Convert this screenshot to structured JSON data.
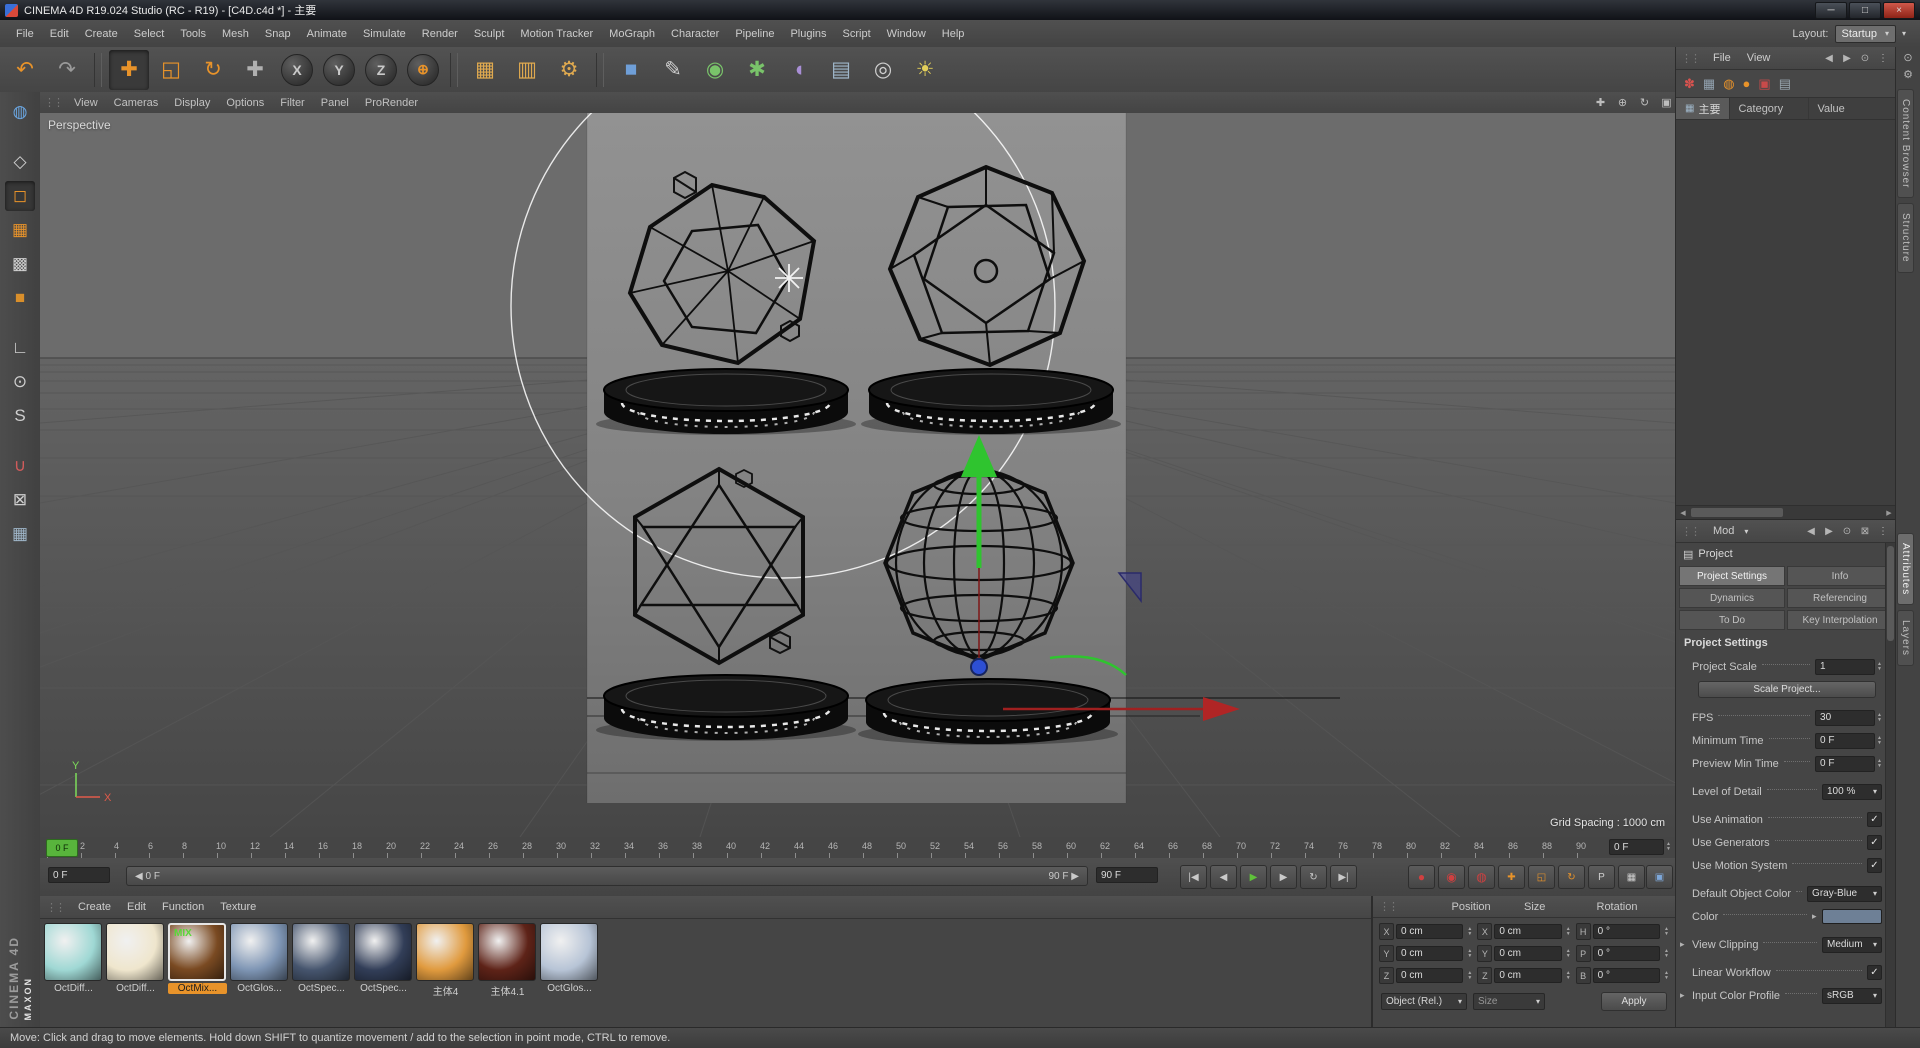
{
  "title_bar": {
    "title": "CINEMA 4D R19.024 Studio (RC - R19) - [C4D.c4d *] - 主要",
    "minimize": "─",
    "maximize": "□",
    "close": "×"
  },
  "menu_bar": {
    "items": [
      "File",
      "Edit",
      "Create",
      "Select",
      "Tools",
      "Mesh",
      "Snap",
      "Animate",
      "Simulate",
      "Render",
      "Sculpt",
      "Motion Tracker",
      "MoGraph",
      "Character",
      "Pipeline",
      "Plugins",
      "Script",
      "Window",
      "Help"
    ],
    "layout_label": "Layout:",
    "layout_value": "Startup"
  },
  "toolbar": {
    "items": [
      {
        "name": "undo-icon",
        "glyph": "↶",
        "fg": "#e8932a"
      },
      {
        "name": "redo-icon",
        "glyph": "↷",
        "fg": "#9a9a9a"
      },
      {
        "name": "toolbar-separator",
        "kind": "sep",
        "inter": "false"
      },
      {
        "name": "move-tool-icon",
        "glyph": "✚",
        "fg": "#e8932a",
        "kind": "active"
      },
      {
        "name": "scale-tool-icon",
        "glyph": "◱",
        "fg": "#e8932a"
      },
      {
        "name": "rotate-tool-icon",
        "glyph": "↻",
        "fg": "#e8932a"
      },
      {
        "name": "last-tool-icon",
        "glyph": "✚",
        "fg": "#b0b0b0"
      },
      {
        "name": "lock-x-axis-icon",
        "glyph": "X",
        "fg": "#c9c9c9",
        "kind": "round"
      },
      {
        "name": "lock-y-axis-icon",
        "glyph": "Y",
        "fg": "#c9c9c9",
        "kind": "round"
      },
      {
        "name": "lock-z-axis-icon",
        "glyph": "Z",
        "fg": "#c9c9c9",
        "kind": "round"
      },
      {
        "name": "coordinate-system-icon",
        "glyph": "⊕",
        "fg": "#e8932a",
        "kind": "round"
      },
      {
        "name": "toolbar-separator",
        "kind": "sep",
        "inter": "false"
      },
      {
        "name": "render-view-icon",
        "glyph": "▦",
        "fg": "#dfa94f"
      },
      {
        "name": "render-picture-viewer-icon",
        "glyph": "▥",
        "fg": "#dfa94f"
      },
      {
        "name": "render-settings-icon",
        "glyph": "⚙",
        "fg": "#dfa94f"
      },
      {
        "name": "toolbar-separator",
        "kind": "sep",
        "inter": "false"
      },
      {
        "name": "primitive-cube-icon",
        "glyph": "■",
        "fg": "#6f9fd8"
      },
      {
        "name": "spline-pen-icon",
        "glyph": "✎",
        "fg": "#cfcfcf"
      },
      {
        "name": "subdivision-surface-icon",
        "glyph": "◉",
        "fg": "#79c36a"
      },
      {
        "name": "cloner-icon",
        "glyph": "✱",
        "fg": "#79c36a"
      },
      {
        "name": "deformer-icon",
        "glyph": "◖",
        "fg": "#a98fd6"
      },
      {
        "name": "array-icon",
        "glyph": "▤",
        "fg": "#9fb6c9"
      },
      {
        "name": "camera-icon",
        "glyph": "◎",
        "fg": "#cfcfcf"
      },
      {
        "name": "light-icon",
        "glyph": "☀",
        "fg": "#e3cf5a"
      }
    ]
  },
  "left_toolbar": {
    "items": [
      {
        "name": "earth-icon",
        "glyph": "◍",
        "fg": "#6aa5e0"
      },
      {
        "name": "make-editable-icon",
        "glyph": "◇",
        "fg": "#cfcfcf",
        "gap": "true"
      },
      {
        "name": "model-mode-icon",
        "glyph": "◻",
        "fg": "#e8932a",
        "active": "true"
      },
      {
        "name": "texture-axis-mode-icon",
        "glyph": "▦",
        "fg": "#e8932a"
      },
      {
        "name": "texture-mode-icon",
        "glyph": "▩",
        "fg": "#cfcfcf"
      },
      {
        "name": "object-mode-icon",
        "glyph": "■",
        "fg": "#d98f2b"
      },
      {
        "name": "workplane-icon",
        "glyph": "∟",
        "fg": "#cfcfcf",
        "gap": "true"
      },
      {
        "name": "mouse-mode-icon",
        "glyph": "⊙",
        "fg": "#cfcfcf"
      },
      {
        "name": "snap-icon",
        "glyph": "S",
        "fg": "#cfcfcf"
      },
      {
        "name": "magnet-snap-icon",
        "glyph": "∪",
        "fg": "#d05b5b",
        "gap": "true"
      },
      {
        "name": "lock-workplane-icon",
        "glyph": "⊠",
        "fg": "#cfcfcf"
      },
      {
        "name": "planar-workplane-icon",
        "glyph": "▦",
        "fg": "#9fb6c9"
      }
    ]
  },
  "viewport": {
    "menu": [
      "View",
      "Cameras",
      "Display",
      "Options",
      "Filter",
      "Panel",
      "ProRender"
    ],
    "corner_icons": [
      {
        "name": "pan-view-icon",
        "glyph": "✚"
      },
      {
        "name": "zoom-view-icon",
        "glyph": "⊕"
      },
      {
        "name": "rotate-view-icon",
        "glyph": "↻"
      },
      {
        "name": "maximize-view-icon",
        "glyph": "▣"
      }
    ],
    "camera_label": "Perspective",
    "grid_spacing": "Grid Spacing : 1000 cm",
    "axis_y": "Y",
    "axis_x": "X"
  },
  "timeline": {
    "frames": [
      "0",
      "2",
      "4",
      "6",
      "8",
      "10",
      "12",
      "14",
      "16",
      "18",
      "20",
      "22",
      "24",
      "26",
      "28",
      "30",
      "32",
      "34",
      "36",
      "38",
      "40",
      "42",
      "44",
      "46",
      "48",
      "50",
      "52",
      "54",
      "56",
      "58",
      "60",
      "62",
      "64",
      "66",
      "68",
      "70",
      "72",
      "74",
      "76",
      "78",
      "80",
      "82",
      "84",
      "86",
      "88",
      "90"
    ],
    "playhead": "0 F",
    "end_field": "0 F"
  },
  "transport": {
    "current": "0 F",
    "range_left_arrow": "◀",
    "range_start": "0 F",
    "range_end": "90 F",
    "range_right_arrow": "▶",
    "end": "90 F",
    "buttons": [
      {
        "name": "goto-start-button",
        "glyph": "|◀",
        "fg": "#c9c9c9"
      },
      {
        "name": "previous-frame-button",
        "glyph": "◀",
        "fg": "#c9c9c9"
      },
      {
        "name": "play-button",
        "glyph": "▶",
        "fg": "#5fc13a"
      },
      {
        "name": "next-frame-button",
        "glyph": "▶",
        "fg": "#c9c9c9"
      },
      {
        "name": "loop-button",
        "glyph": "↻",
        "fg": "#c9c9c9"
      },
      {
        "name": "goto-end-button",
        "glyph": "▶|",
        "fg": "#c9c9c9"
      }
    ],
    "record_buttons": [
      {
        "name": "record-keyframe-button",
        "glyph": "●",
        "fg": "#d04040"
      },
      {
        "name": "autokey-button",
        "glyph": "◉",
        "fg": "#d04040"
      },
      {
        "name": "record-options-button",
        "glyph": "◍",
        "fg": "#d04040"
      }
    ],
    "toggles": [
      {
        "name": "record-position-toggle",
        "glyph": "✚",
        "fg": "#e8932a"
      },
      {
        "name": "record-scale-toggle",
        "glyph": "◱",
        "fg": "#e8932a"
      },
      {
        "name": "record-rotation-toggle",
        "glyph": "↻",
        "fg": "#e8932a"
      },
      {
        "name": "record-parameter-toggle",
        "glyph": "P",
        "fg": "#cfcfcf"
      },
      {
        "name": "record-pla-toggle",
        "glyph": "▦",
        "fg": "#cfcfcf"
      }
    ],
    "layout_button": {
      "name": "powerslider-layout-button",
      "glyph": "▣",
      "fg": "#7da7d9"
    }
  },
  "materials": {
    "menus": [
      "Create",
      "Edit",
      "Function",
      "Texture"
    ],
    "items": [
      {
        "label": "OctDiff...",
        "color": "#9fd8d4"
      },
      {
        "label": "OctDiff...",
        "color": "#efe6cd"
      },
      {
        "label": "OctMix...",
        "color": "#7a4a22",
        "selected": "true",
        "overlay": "MIX"
      },
      {
        "label": "OctGlos...",
        "color": "#7e95b4"
      },
      {
        "label": "OctSpec...",
        "color": "#46556e"
      },
      {
        "label": "OctSpec...",
        "color": "#323e58"
      },
      {
        "label": "主体4",
        "color": "#e09a3e"
      },
      {
        "label": "主体4.1",
        "color": "#5e2318"
      },
      {
        "label": "OctGlos...",
        "color": "#b7c4d6"
      }
    ]
  },
  "coordinates": {
    "headers": [
      "Position",
      "Size",
      "Rotation"
    ],
    "rows": [
      {
        "a": "X",
        "av": "0 cm",
        "b": "X",
        "bv": "0 cm",
        "c": "H",
        "cv": "0 °"
      },
      {
        "a": "Y",
        "av": "0 cm",
        "b": "Y",
        "bv": "0 cm",
        "c": "P",
        "cv": "0 °"
      },
      {
        "a": "Z",
        "av": "0 cm",
        "b": "Z",
        "bv": "0 cm",
        "c": "B",
        "cv": "0 °"
      }
    ],
    "object_mode": "Object (Rel.)",
    "size_mode": "Size",
    "apply": "Apply"
  },
  "object_manager": {
    "menus": [
      "File",
      "View"
    ],
    "icons": [
      {
        "name": "bookmark-new-icon",
        "glyph": "✽",
        "fg": "#d9534f"
      },
      {
        "name": "bookmark-icon",
        "glyph": "▦",
        "fg": "#93a3b1"
      },
      {
        "name": "filter-icon",
        "glyph": "◍",
        "fg": "#e8932a"
      },
      {
        "name": "target-icon",
        "glyph": "●",
        "fg": "#e8932a"
      },
      {
        "name": "layout-red-icon",
        "glyph": "▣",
        "fg": "#c94a4a"
      },
      {
        "name": "layout-grey-icon",
        "glyph": "▤",
        "fg": "#9aa7b0"
      }
    ],
    "tab": "主要",
    "columns": [
      "Category",
      "Value"
    ]
  },
  "attribute_manager": {
    "mode": "Mod",
    "object_label": "Project",
    "tabs": [
      {
        "label": "Project Settings",
        "active": "true"
      },
      {
        "label": "Info"
      },
      {
        "label": "Dynamics"
      },
      {
        "label": "Referencing"
      },
      {
        "label": "To Do"
      },
      {
        "label": "Key Interpolation"
      }
    ],
    "section": "Project Settings",
    "rows": {
      "project_scale": {
        "label": "Project Scale",
        "value": "1"
      },
      "scale_project": "Scale Project...",
      "fps": {
        "label": "FPS",
        "value": "30"
      },
      "minimum_time": {
        "label": "Minimum Time",
        "value": "0 F"
      },
      "preview_min_time": {
        "label": "Preview Min Time",
        "value": "0 F"
      },
      "level_of_detail": {
        "label": "Level of Detail",
        "value": "100 %"
      },
      "use_animation": {
        "label": "Use Animation",
        "checked": true
      },
      "use_generators": {
        "label": "Use Generators",
        "checked": true
      },
      "use_motion_system": {
        "label": "Use Motion System",
        "checked": true
      },
      "default_object_color": {
        "label": "Default Object Color",
        "value": "Gray-Blue"
      },
      "color": {
        "label": "Color",
        "swatch": "#6e8096"
      },
      "view_clipping": {
        "label": "View Clipping",
        "value": "Medium"
      },
      "linear_workflow": {
        "label": "Linear Workflow",
        "checked": true
      },
      "input_color_profile": {
        "label": "Input Color Profile",
        "value": "sRGB"
      }
    }
  },
  "right_strip": {
    "top_tabs": [
      "Content Browser",
      "Structure"
    ],
    "bottom_tabs": [
      {
        "label": "Attributes",
        "active": "true"
      },
      {
        "label": "Layers"
      }
    ]
  },
  "status_bar": {
    "text": "Move: Click and drag to move elements. Hold down SHIFT to quantize movement / add to the selection in point mode, CTRL to remove."
  },
  "branding": {
    "maxon": "MAXON",
    "cinema": "CINEMA 4D"
  },
  "colors": {
    "accent": "#e8932a",
    "play_green": "#5fc13a",
    "viewport_bg": "#6c6c6c",
    "backdrop": "#8f8f8f"
  }
}
